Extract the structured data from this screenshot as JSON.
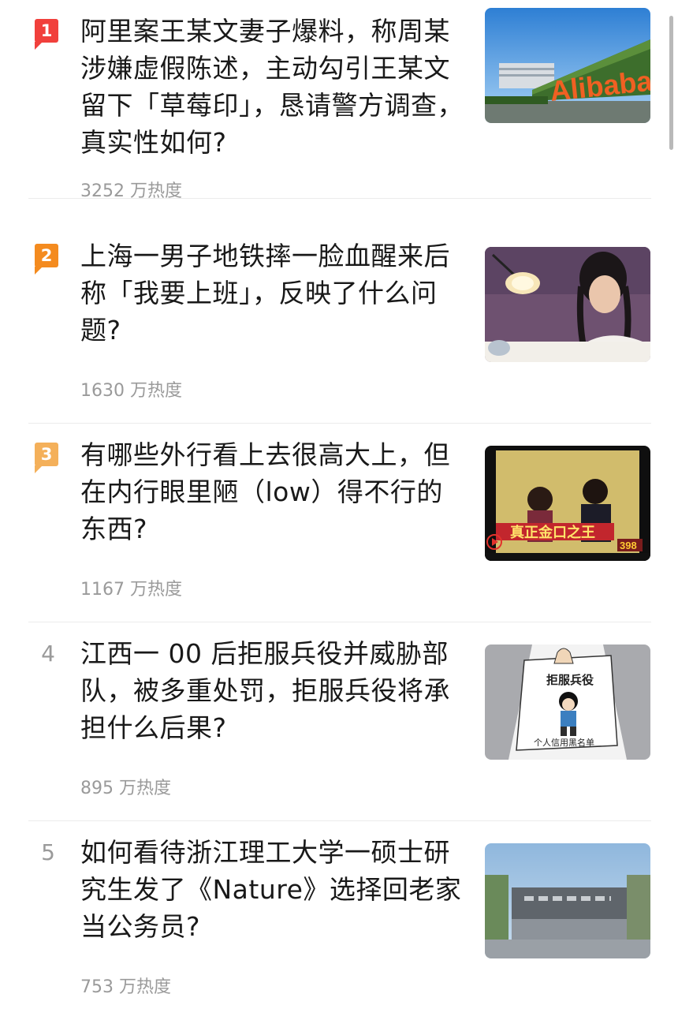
{
  "hot_list": {
    "items": [
      {
        "rank": "1",
        "rank_style": "badge",
        "badge_color": "#f1403c",
        "title": "阿里案王某文妻子爆料，称周某涉嫌虚假陈述，主动勾引王某文留下「草莓印」，恳请警方调查，真实性如何?",
        "heat": "3252 万热度",
        "thumb": {
          "subject": "alibaba-building-photo",
          "logo_text": "Alibaba"
        }
      },
      {
        "rank": "2",
        "rank_style": "badge",
        "badge_color": "#f48b1f",
        "title": "上海一男子地铁摔一脸血醒来后称「我要上班」，反映了什么问题?",
        "heat": "1630 万热度",
        "thumb": {
          "subject": "woman-writing-photo"
        }
      },
      {
        "rank": "3",
        "rank_style": "badge",
        "badge_color": "#f4b05a",
        "title": "有哪些外行看上去很高大上，但在内行眼里陋（low）得不行的东西?",
        "heat": "1167 万热度",
        "thumb": {
          "subject": "tv-show-video-still",
          "caption": "真正金口之王",
          "badge_number": "398",
          "play_icon": "play-icon"
        }
      },
      {
        "rank": "4",
        "rank_style": "plain",
        "title": "江西一 00 后拒服兵役并威胁部队，被多重处罚，拒服兵役将承担什么后果?",
        "heat": "895 万热度",
        "thumb": {
          "subject": "cartoon-illustration",
          "sign_text": "拒服兵役",
          "bottom_text": "个人信用黑名单"
        }
      },
      {
        "rank": "5",
        "rank_style": "plain",
        "title": "如何看待浙江理工大学一硕士研究生发了《Nature》选择回老家当公务员?",
        "heat": "753 万热度",
        "thumb": {
          "subject": "university-gate-photo"
        }
      }
    ]
  }
}
